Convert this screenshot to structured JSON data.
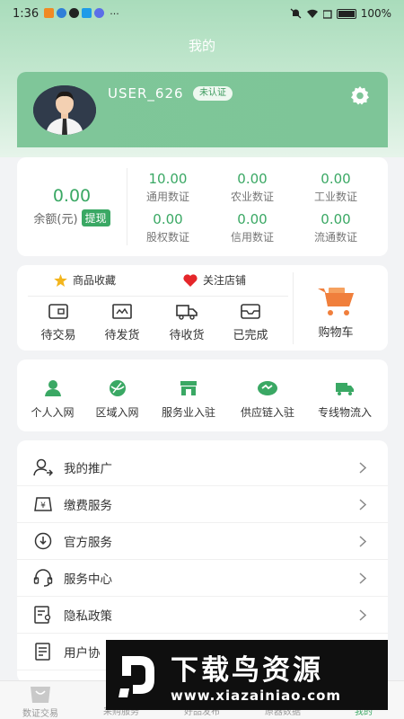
{
  "status_bar": {
    "time": "1:36",
    "battery": "100%"
  },
  "page": {
    "title": "我的"
  },
  "user": {
    "name": "USER_626",
    "badge": "未认证"
  },
  "wallet": {
    "balance": "0.00",
    "balance_label": "余额(元)",
    "withdraw_label": "提现",
    "certs": [
      {
        "value": "10.00",
        "label": "通用数证"
      },
      {
        "value": "0.00",
        "label": "农业数证"
      },
      {
        "value": "0.00",
        "label": "工业数证"
      },
      {
        "value": "0.00",
        "label": "股权数证"
      },
      {
        "value": "0.00",
        "label": "信用数证"
      },
      {
        "value": "0.00",
        "label": "流通数证"
      }
    ]
  },
  "orders": {
    "favorites": "商品收藏",
    "follow": "关注店铺",
    "states": [
      "待交易",
      "待发货",
      "待收货",
      "已完成"
    ],
    "cart": "购物车"
  },
  "join": [
    "个人入网",
    "区域入网",
    "服务业入驻",
    "供应链入驻",
    "专线物流入"
  ],
  "menu": [
    "我的推广",
    "缴费服务",
    "官方服务",
    "服务中心",
    "隐私政策",
    "用户协"
  ],
  "tabbar": [
    "数证交易",
    "采购服务",
    "好品发布",
    "原器数据",
    "我的"
  ],
  "watermark": {
    "title": "下载鸟资源",
    "url": "www.xiazainiao.com"
  },
  "colors": {
    "accent": "#3aa864",
    "header": "#7fc699",
    "favorite_star": "#f3b51d",
    "heart": "#e5262a",
    "cart": "#f07f3c"
  }
}
